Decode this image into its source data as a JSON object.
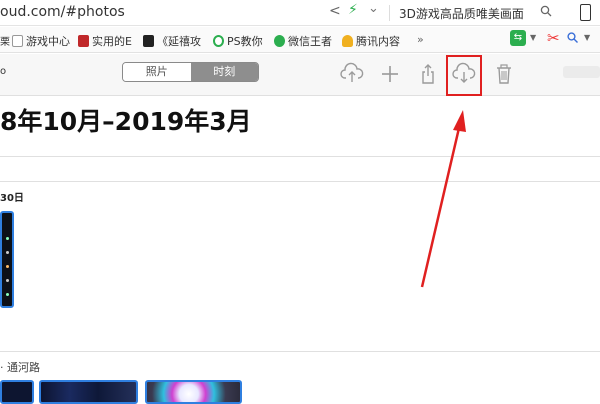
{
  "browser": {
    "url": "oud.com/#photos",
    "search_text": "3D游戏高品质唯美画面"
  },
  "bookmarks": {
    "left_edge": "栗",
    "items": [
      {
        "label": "游戏中心"
      },
      {
        "label": "实用的E"
      },
      {
        "label": "《延禧攻"
      },
      {
        "label": "PS教你"
      },
      {
        "label": "微信王者"
      },
      {
        "label": "腾讯内容"
      }
    ],
    "more": "»"
  },
  "app_toolbar": {
    "left_edge": "o",
    "segments": [
      "照片",
      "时刻"
    ],
    "selected": "时刻"
  },
  "content": {
    "heading": "8年10月–2019年3月",
    "first_date": "30日",
    "location": "· 通河路"
  },
  "colors": {
    "highlight": "#e02020",
    "selection": "#2f7fe0",
    "accent_green": "#2cae4f"
  }
}
